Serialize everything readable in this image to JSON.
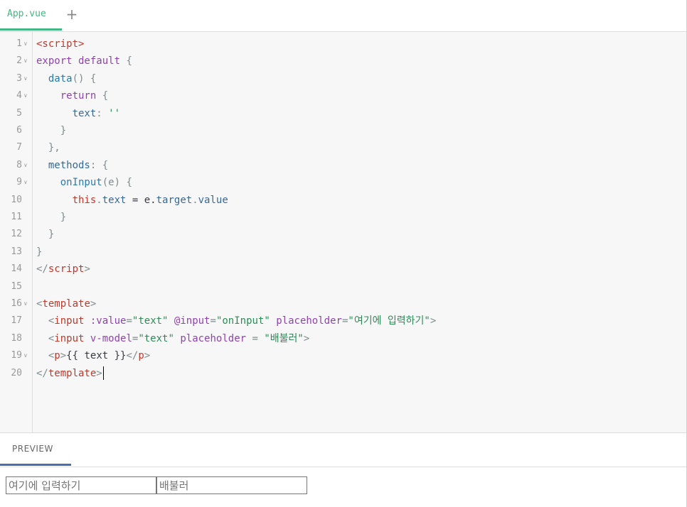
{
  "tabs": [
    {
      "label": "App.vue",
      "active": true
    }
  ],
  "add_tab_label": "+",
  "editor": {
    "lines": [
      {
        "n": "1",
        "fold": true,
        "tokens": [
          [
            "t-tag",
            "<script>"
          ]
        ]
      },
      {
        "n": "2",
        "fold": true,
        "tokens": [
          [
            "t-kw",
            "export default "
          ],
          [
            "t-punct",
            "{"
          ]
        ]
      },
      {
        "n": "3",
        "fold": true,
        "tokens": [
          [
            "t-plain",
            "  "
          ],
          [
            "t-fn",
            "data"
          ],
          [
            "t-punct",
            "() {"
          ]
        ]
      },
      {
        "n": "4",
        "fold": true,
        "tokens": [
          [
            "t-plain",
            "    "
          ],
          [
            "t-kw",
            "return "
          ],
          [
            "t-punct",
            "{"
          ]
        ]
      },
      {
        "n": "5",
        "fold": false,
        "tokens": [
          [
            "t-plain",
            "      "
          ],
          [
            "t-prop",
            "text"
          ],
          [
            "t-punct",
            ": "
          ],
          [
            "t-str",
            "''"
          ]
        ]
      },
      {
        "n": "6",
        "fold": false,
        "tokens": [
          [
            "t-plain",
            "    "
          ],
          [
            "t-punct",
            "}"
          ]
        ]
      },
      {
        "n": "7",
        "fold": false,
        "tokens": [
          [
            "t-plain",
            "  "
          ],
          [
            "t-punct",
            "},"
          ]
        ]
      },
      {
        "n": "8",
        "fold": true,
        "tokens": [
          [
            "t-plain",
            "  "
          ],
          [
            "t-prop",
            "methods"
          ],
          [
            "t-punct",
            ": {"
          ]
        ]
      },
      {
        "n": "9",
        "fold": true,
        "tokens": [
          [
            "t-plain",
            "    "
          ],
          [
            "t-fn",
            "onInput"
          ],
          [
            "t-punct",
            "(e) {"
          ]
        ]
      },
      {
        "n": "10",
        "fold": false,
        "tokens": [
          [
            "t-plain",
            "      "
          ],
          [
            "t-this",
            "this"
          ],
          [
            "t-punct",
            "."
          ],
          [
            "t-prop",
            "text"
          ],
          [
            "t-plain",
            " = e."
          ],
          [
            "t-prop",
            "target"
          ],
          [
            "t-punct",
            "."
          ],
          [
            "t-prop",
            "value"
          ]
        ]
      },
      {
        "n": "11",
        "fold": false,
        "tokens": [
          [
            "t-plain",
            "    "
          ],
          [
            "t-punct",
            "}"
          ]
        ]
      },
      {
        "n": "12",
        "fold": false,
        "tokens": [
          [
            "t-plain",
            "  "
          ],
          [
            "t-punct",
            "}"
          ]
        ]
      },
      {
        "n": "13",
        "fold": false,
        "tokens": [
          [
            "t-punct",
            "}"
          ]
        ]
      },
      {
        "n": "14",
        "fold": false,
        "tokens": [
          [
            "t-punct",
            "</"
          ],
          [
            "t-tag",
            "script"
          ],
          [
            "t-punct",
            ">"
          ]
        ]
      },
      {
        "n": "15",
        "fold": false,
        "tokens": []
      },
      {
        "n": "16",
        "fold": true,
        "tokens": [
          [
            "t-punct",
            "<"
          ],
          [
            "t-tag",
            "template"
          ],
          [
            "t-punct",
            ">"
          ]
        ]
      },
      {
        "n": "17",
        "fold": false,
        "tokens": [
          [
            "t-plain",
            "  "
          ],
          [
            "t-punct",
            "<"
          ],
          [
            "t-tag",
            "input"
          ],
          [
            "t-attr",
            " :value"
          ],
          [
            "t-punct",
            "="
          ],
          [
            "t-str",
            "\"text\""
          ],
          [
            "t-attr",
            " @input"
          ],
          [
            "t-punct",
            "="
          ],
          [
            "t-str",
            "\"onInput\""
          ],
          [
            "t-attr",
            " placeholder"
          ],
          [
            "t-punct",
            "="
          ],
          [
            "t-str",
            "\"여기에 입력하기\""
          ],
          [
            "t-punct",
            ">"
          ]
        ]
      },
      {
        "n": "18",
        "fold": false,
        "tokens": [
          [
            "t-plain",
            "  "
          ],
          [
            "t-punct",
            "<"
          ],
          [
            "t-tag",
            "input"
          ],
          [
            "t-attr",
            " v-model"
          ],
          [
            "t-punct",
            "="
          ],
          [
            "t-str",
            "\"text\""
          ],
          [
            "t-attr",
            " placeholder"
          ],
          [
            "t-punct",
            " = "
          ],
          [
            "t-str",
            "\"배불러\""
          ],
          [
            "t-punct",
            ">"
          ]
        ]
      },
      {
        "n": "19",
        "fold": true,
        "tokens": [
          [
            "t-plain",
            "  "
          ],
          [
            "t-punct",
            "<"
          ],
          [
            "t-tag",
            "p"
          ],
          [
            "t-punct",
            ">"
          ],
          [
            "t-plain",
            "{{ text }}"
          ],
          [
            "t-punct",
            "</"
          ],
          [
            "t-tag",
            "p"
          ],
          [
            "t-punct",
            ">"
          ]
        ]
      },
      {
        "n": "20",
        "fold": false,
        "caret": true,
        "tokens": [
          [
            "t-punct",
            "</"
          ],
          [
            "t-tag",
            "template"
          ],
          [
            "t-punct",
            ">"
          ]
        ]
      }
    ]
  },
  "preview": {
    "tab_label": "PREVIEW",
    "input1_placeholder": "여기에 입력하기",
    "input1_value": "",
    "input2_placeholder": "배불러",
    "input2_value": "",
    "paragraph_text": ""
  },
  "colors": {
    "vue_green": "#42b883",
    "preview_accent": "#4a6fb0",
    "editor_bg": "#f7f7f7"
  }
}
